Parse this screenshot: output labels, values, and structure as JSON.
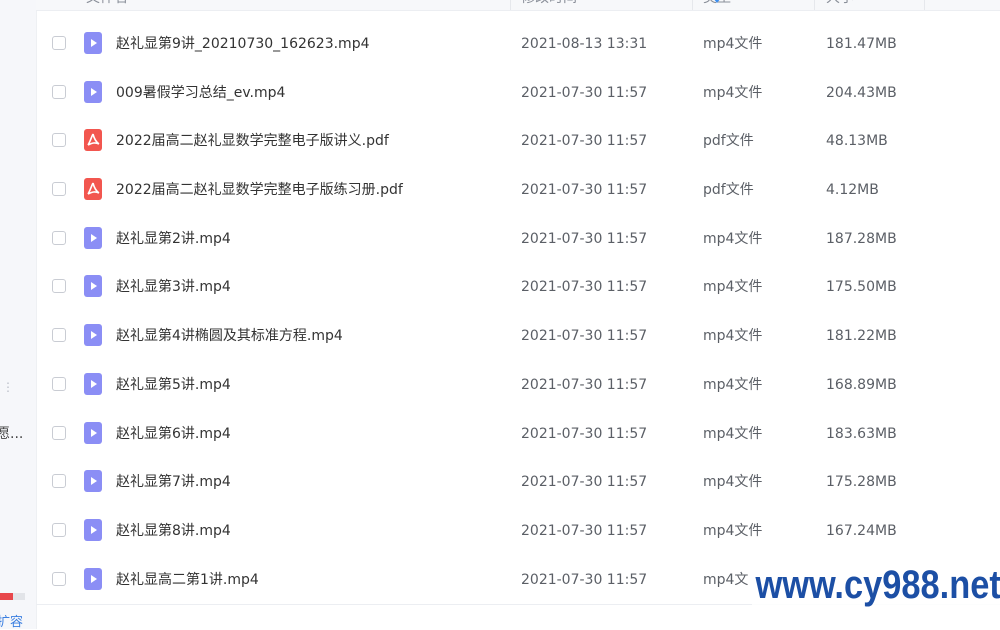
{
  "header": {
    "name": "文件名",
    "modified": "修改时间",
    "type": "类型",
    "size": "大小"
  },
  "sidebar": {
    "cut_text": "愿...",
    "expand_text": "扩容"
  },
  "files": [
    {
      "name": "赵礼显第9讲_20210730_162623.mp4",
      "date": "2021-08-13 13:31",
      "type": "mp4文件",
      "size": "181.47MB",
      "icon": "video-file-icon"
    },
    {
      "name": "009暑假学习总结_ev.mp4",
      "date": "2021-07-30 11:57",
      "type": "mp4文件",
      "size": "204.43MB",
      "icon": "video-file-icon"
    },
    {
      "name": "2022届高二赵礼显数学完整电子版讲义.pdf",
      "date": "2021-07-30 11:57",
      "type": "pdf文件",
      "size": "48.13MB",
      "icon": "pdf-file-icon"
    },
    {
      "name": "2022届高二赵礼显数学完整电子版练习册.pdf",
      "date": "2021-07-30 11:57",
      "type": "pdf文件",
      "size": "4.12MB",
      "icon": "pdf-file-icon"
    },
    {
      "name": "赵礼显第2讲.mp4",
      "date": "2021-07-30 11:57",
      "type": "mp4文件",
      "size": "187.28MB",
      "icon": "video-file-icon"
    },
    {
      "name": "赵礼显第3讲.mp4",
      "date": "2021-07-30 11:57",
      "type": "mp4文件",
      "size": "175.50MB",
      "icon": "video-file-icon"
    },
    {
      "name": "赵礼显第4讲椭圆及其标准方程.mp4",
      "date": "2021-07-30 11:57",
      "type": "mp4文件",
      "size": "181.22MB",
      "icon": "video-file-icon"
    },
    {
      "name": "赵礼显第5讲.mp4",
      "date": "2021-07-30 11:57",
      "type": "mp4文件",
      "size": "168.89MB",
      "icon": "video-file-icon"
    },
    {
      "name": "赵礼显第6讲.mp4",
      "date": "2021-07-30 11:57",
      "type": "mp4文件",
      "size": "183.63MB",
      "icon": "video-file-icon"
    },
    {
      "name": "赵礼显第7讲.mp4",
      "date": "2021-07-30 11:57",
      "type": "mp4文件",
      "size": "175.28MB",
      "icon": "video-file-icon"
    },
    {
      "name": "赵礼显第8讲.mp4",
      "date": "2021-07-30 11:57",
      "type": "mp4文件",
      "size": "167.24MB",
      "icon": "video-file-icon"
    },
    {
      "name": "赵礼显高二第1讲.mp4",
      "date": "2021-07-30 11:57",
      "type": "mp4文",
      "size": "",
      "icon": "video-file-icon"
    }
  ],
  "watermark": "www.cy988.net",
  "colors": {
    "video_icon": "#8b8ef5",
    "pdf_icon": "#f2564f",
    "sort_indicator": "#3b8ef0",
    "watermark": "#1c4fa5"
  }
}
